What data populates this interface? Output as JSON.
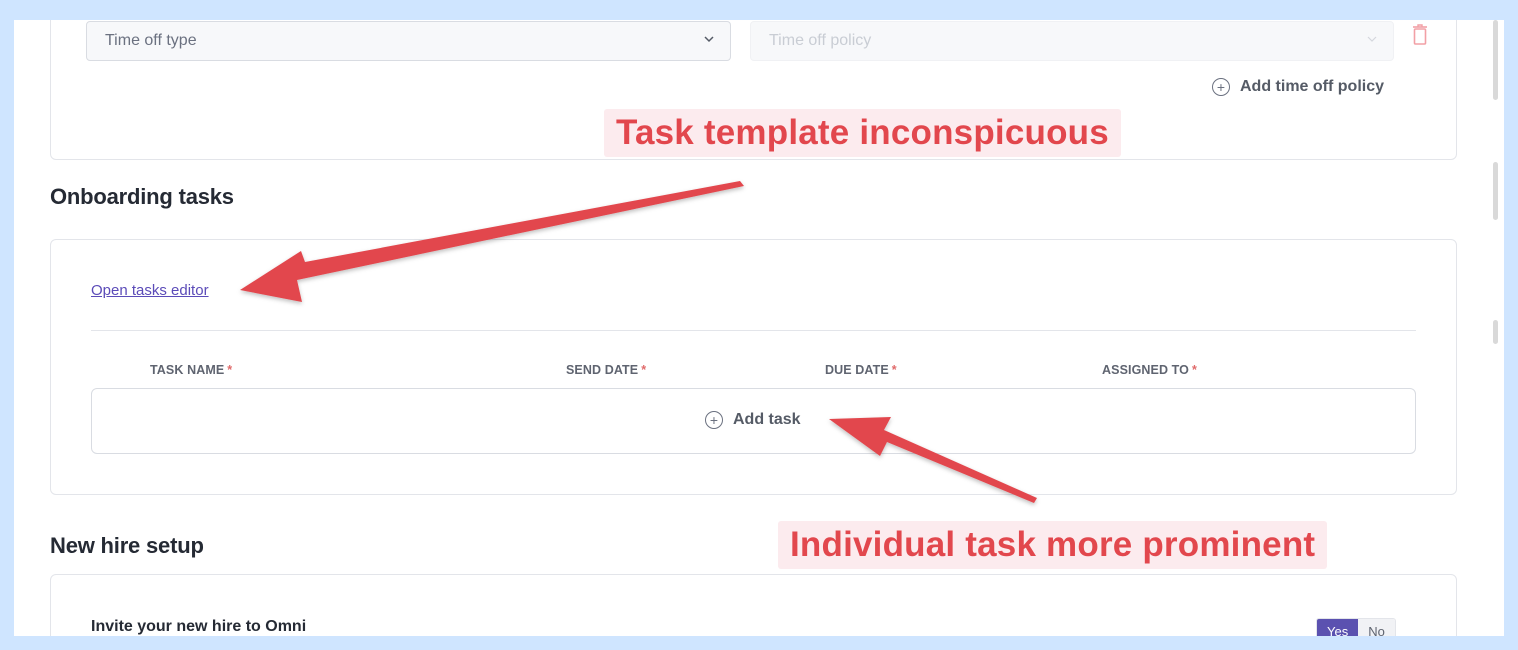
{
  "time_off": {
    "type_placeholder": "Time off type",
    "policy_placeholder": "Time off policy",
    "add_policy_label": "Add time off policy"
  },
  "onboarding": {
    "title": "Onboarding tasks",
    "open_editor_label": "Open tasks editor",
    "columns": [
      {
        "label": "TASK NAME",
        "required": "*"
      },
      {
        "label": "SEND DATE",
        "required": "*"
      },
      {
        "label": "DUE DATE",
        "required": "*"
      },
      {
        "label": "ASSIGNED TO",
        "required": "*"
      }
    ],
    "add_task_label": "Add task"
  },
  "new_hire": {
    "title": "New hire setup",
    "invite_label": "Invite your new hire to Omni",
    "toggle_yes": "Yes",
    "toggle_no": "No",
    "toggle_selected": "Yes"
  },
  "annotations": {
    "top": "Task template inconspicuous",
    "bottom": "Individual task more prominent",
    "color": "#e2474d"
  },
  "colors": {
    "background": "#cfe5ff",
    "accent": "#5b51b0",
    "link": "#5b4bb8",
    "delete": "#f2a0a6"
  },
  "icons": {
    "chevron": "chevron-down-icon",
    "delete": "trash-icon",
    "add": "plus-circle-icon"
  }
}
